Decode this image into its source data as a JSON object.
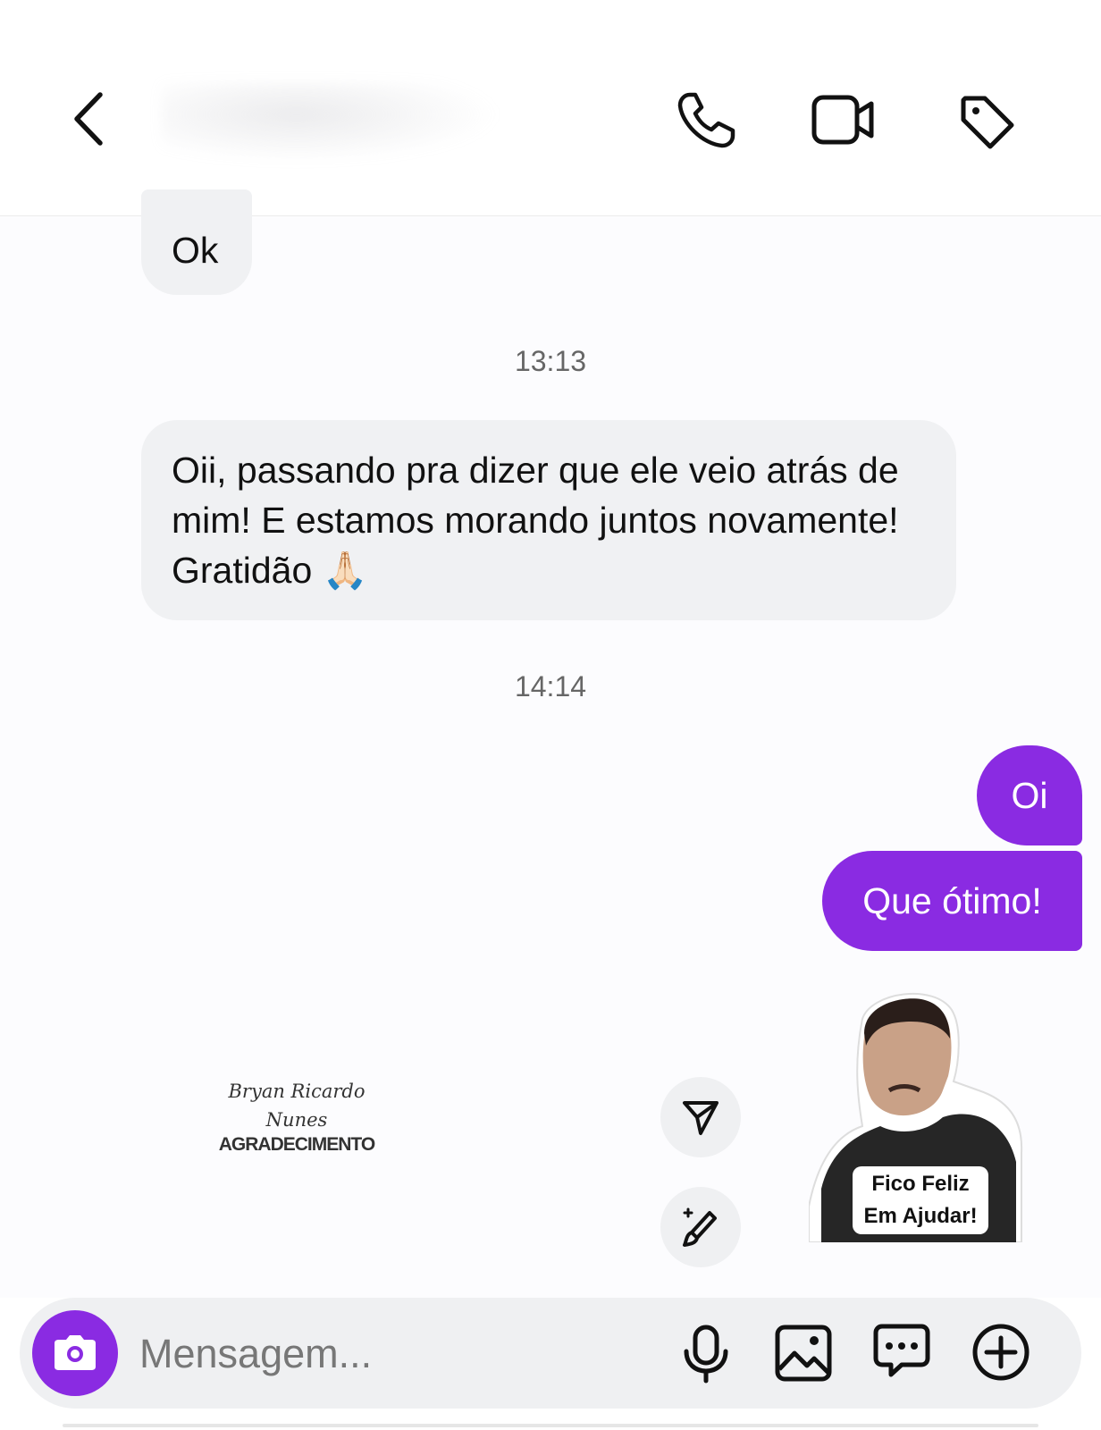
{
  "header": {
    "back_icon": "chevron-left-icon",
    "actions": [
      "phone-icon",
      "video-camera-icon",
      "tag-icon"
    ]
  },
  "messages": {
    "ok": "Ok",
    "ts1": "13:13",
    "long": "Oii, passando pra dizer que ele veio atrás de mim! E estamos morando juntos novamente! Gratidão 🙏🏻",
    "ts2": "14:14",
    "oi": "Oi",
    "que_otimo": "Que ótimo!"
  },
  "sticker": {
    "line1": "Fico Feliz",
    "line2": "Em Ajudar!"
  },
  "watermark": {
    "signature_line1": "Bryan Ricardo",
    "signature_line2": "Nunes",
    "title": "AGRADECIMENTO"
  },
  "side_actions": [
    "send-icon",
    "paint-brush-icon"
  ],
  "composer": {
    "placeholder": "Mensagem...",
    "icons": [
      "camera-icon",
      "microphone-icon",
      "image-icon",
      "chat-more-icon",
      "plus-circle-icon"
    ]
  },
  "colors": {
    "accent": "#8a2be2",
    "incoming_bubble": "#f0f1f3"
  }
}
